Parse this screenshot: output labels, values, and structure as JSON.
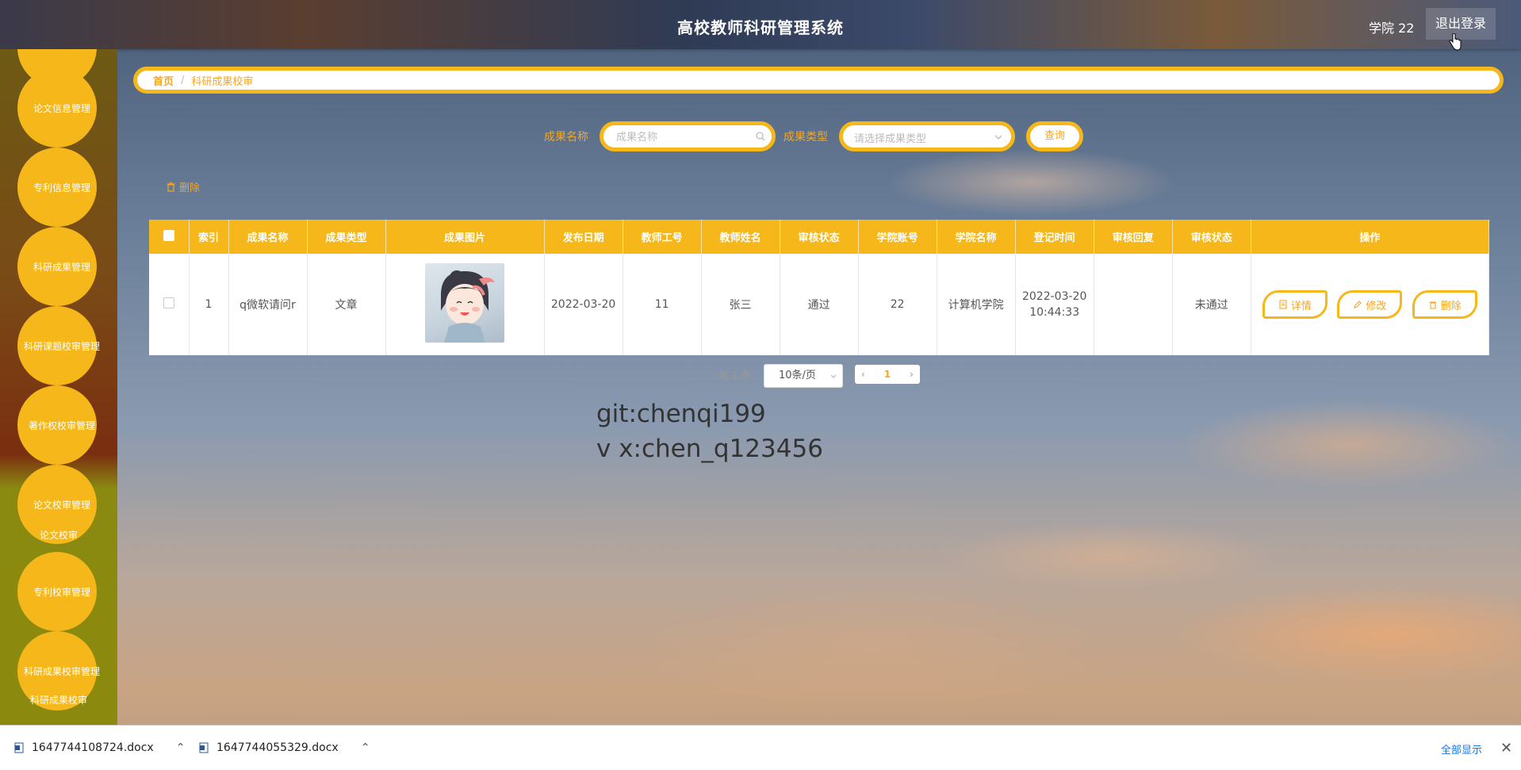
{
  "header": {
    "title": "高校教师科研管理系统",
    "user": "学院 22",
    "logout": "退出登录"
  },
  "sidebar": {
    "items": [
      {
        "label": "论文信息管理"
      },
      {
        "label": "专利信息管理"
      },
      {
        "label": "科研成果管理"
      },
      {
        "label": "科研课题校审管理"
      },
      {
        "label": "著作权校审管理"
      },
      {
        "label": "论文校审管理"
      },
      {
        "label": "专利校审管理"
      },
      {
        "label": "科研成果校审管理"
      }
    ],
    "sub_items": [
      "论文校审",
      "科研成果校审"
    ]
  },
  "breadcrumb": {
    "home": "首页",
    "separator": "/",
    "current": "科研成果校审"
  },
  "search": {
    "name_label": "成果名称",
    "name_placeholder": "成果名称",
    "type_label": "成果类型",
    "type_placeholder": "请选择成果类型",
    "query_button": "查询"
  },
  "toolbar": {
    "delete_label": "删除"
  },
  "table": {
    "headers": [
      "索引",
      "成果名称",
      "成果类型",
      "成果图片",
      "发布日期",
      "教师工号",
      "教师姓名",
      "审核状态",
      "学院账号",
      "学院名称",
      "登记时间",
      "审核回复",
      "审核状态",
      "操作"
    ],
    "rows": [
      {
        "index": "1",
        "name": "q微软请问r",
        "type": "文章",
        "date": "2022-03-20",
        "teacher_no": "11",
        "teacher_name": "张三",
        "status": "通过",
        "college_account": "22",
        "college_name": "计算机学院",
        "reg_date": "2022-03-20",
        "reg_time": "10:44:33",
        "reply": "",
        "review_status": "未通过"
      }
    ],
    "actions": {
      "detail": "详情",
      "edit": "修改",
      "delete": "删除"
    }
  },
  "pagination": {
    "total": "共 1 条",
    "page_size": "10条/页",
    "current_page": "1"
  },
  "watermark": {
    "line1": "git:chenqi199",
    "line2": "v x:chen_q123456"
  },
  "downloads": {
    "files": [
      "1647744108724.docx",
      "1647744055329.docx"
    ],
    "show_all": "全部显示"
  },
  "colors": {
    "accent": "#f5b719",
    "accent_text": "#f5a623"
  }
}
